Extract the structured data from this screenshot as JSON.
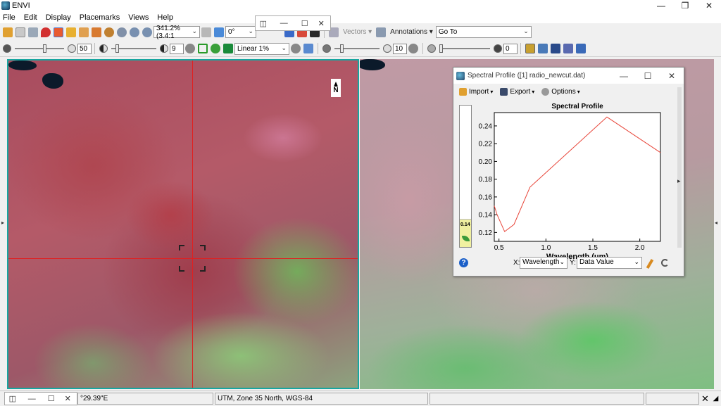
{
  "window": {
    "title": "ENVI",
    "minimize": "—",
    "restore": "❐",
    "close": "✕"
  },
  "menu": [
    "File",
    "Edit",
    "Display",
    "Placemarks",
    "Views",
    "Help"
  ],
  "toolbar1": {
    "zoom_value": "341.2% (3.4:1",
    "rotation_value": "0°",
    "vectors_label": "Vectors",
    "annotations_label": "Annotations",
    "goto_value": "Go To"
  },
  "toolbar2": {
    "brightness_value": "50",
    "contrast_value": "9",
    "stretch_value": "Linear 1%",
    "sharpen_value": "10",
    "transparency_value": "0"
  },
  "mini_window": {
    "minimize": "—",
    "restore": "☐",
    "close": "✕"
  },
  "view": {
    "north_label": "N"
  },
  "spectral_profile": {
    "title": "Spectral Profile ([1] radio_newcut.dat)",
    "import_label": "Import",
    "export_label": "Export",
    "options_label": "Options",
    "current_value": "0.14",
    "x_axis_prefix": "X:",
    "x_axis_value": "Wavelength",
    "y_axis_prefix": "Y:",
    "y_axis_value": "Data Value",
    "help": "?"
  },
  "chart_data": {
    "type": "line",
    "title": "Spectral Profile",
    "xlabel": "Wavelength (um)",
    "ylabel": "",
    "xlim": [
      0.45,
      2.22
    ],
    "ylim": [
      0.11,
      0.255
    ],
    "xticks": [
      "0.5",
      "1.0",
      "1.5",
      "2.0"
    ],
    "yticks": [
      "0.12",
      "0.14",
      "0.16",
      "0.18",
      "0.20",
      "0.22",
      "0.24"
    ],
    "grid": false,
    "series": [
      {
        "color": "#e8463a",
        "x": [
          0.45,
          0.48,
          0.56,
          0.66,
          0.83,
          1.65,
          2.22
        ],
        "y": [
          0.15,
          0.14,
          0.121,
          0.129,
          0.171,
          0.25,
          0.21
        ]
      }
    ]
  },
  "statusbar": {
    "coordinates": "°29.39\"E",
    "projection": "UTM, Zone 35 North, WGS-84",
    "close": "✕"
  }
}
